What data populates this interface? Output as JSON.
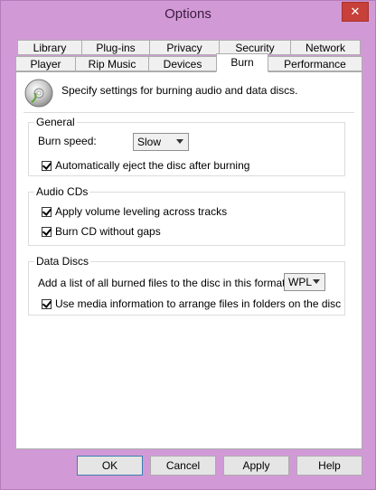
{
  "window": {
    "title": "Options",
    "close_glyph": "✕"
  },
  "tabs_row1": [
    {
      "label": "Library"
    },
    {
      "label": "Plug-ins"
    },
    {
      "label": "Privacy"
    },
    {
      "label": "Security"
    },
    {
      "label": "Network"
    }
  ],
  "tabs_row2": [
    {
      "label": "Player"
    },
    {
      "label": "Rip Music"
    },
    {
      "label": "Devices"
    },
    {
      "label": "Burn"
    },
    {
      "label": "Performance"
    }
  ],
  "active_tab": "Burn",
  "header": {
    "text": "Specify settings for burning audio and data discs.",
    "icon": "disc-icon"
  },
  "general": {
    "title": "General",
    "burn_speed_label": "Burn speed:",
    "burn_speed_value": "Slow",
    "auto_eject_label": "Automatically eject the disc after burning",
    "auto_eject_checked": true
  },
  "audio_cds": {
    "title": "Audio CDs",
    "volume_leveling_label": "Apply volume leveling across tracks",
    "volume_leveling_checked": true,
    "no_gaps_label": "Burn CD without gaps",
    "no_gaps_checked": true
  },
  "data_discs": {
    "title": "Data Discs",
    "format_label": "Add a list of all burned files to the disc in this format:",
    "format_value": "WPL",
    "media_info_label": "Use media information to arrange files in folders on the disc",
    "media_info_checked": true
  },
  "footer": {
    "ok": "OK",
    "cancel": "Cancel",
    "apply": "Apply",
    "help": "Help"
  }
}
